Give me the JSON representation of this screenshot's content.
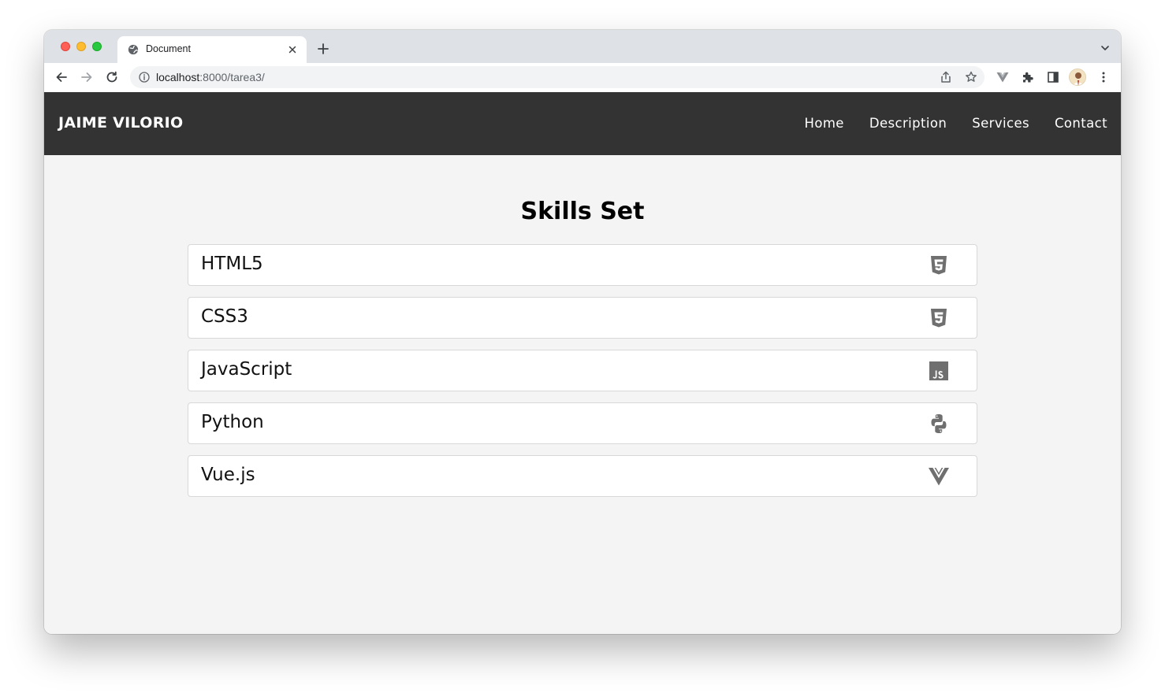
{
  "browser": {
    "tab_title": "Document",
    "url_host": "localhost",
    "url_path": ":8000/tarea3/"
  },
  "navbar": {
    "brand": "JAIME VILORIO",
    "links": [
      {
        "label": "Home"
      },
      {
        "label": "Description"
      },
      {
        "label": "Services"
      },
      {
        "label": "Contact"
      }
    ]
  },
  "main": {
    "title": "Skills Set",
    "skills": [
      {
        "name": "HTML5",
        "icon": "html5-icon"
      },
      {
        "name": "CSS3",
        "icon": "css3-icon"
      },
      {
        "name": "JavaScript",
        "icon": "javascript-icon"
      },
      {
        "name": "Python",
        "icon": "python-icon"
      },
      {
        "name": "Vue.js",
        "icon": "vuejs-icon"
      }
    ]
  },
  "colors": {
    "navbar_bg": "#333333",
    "page_bg": "#f4f4f4",
    "icon_color": "#6f6f6f"
  }
}
